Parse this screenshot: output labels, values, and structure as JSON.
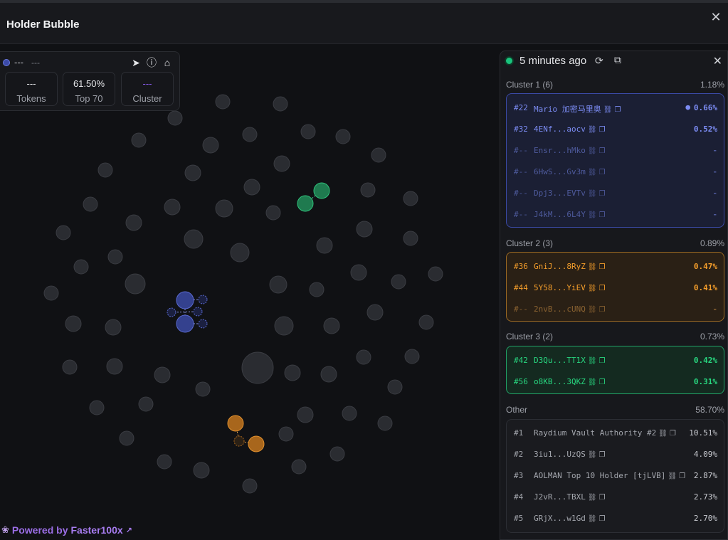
{
  "header": {
    "title": "Holder Bubble",
    "close_icon": "close-icon"
  },
  "token": {
    "name": "---",
    "symbol": "---",
    "stats": [
      {
        "value": "---",
        "label": "Tokens"
      },
      {
        "value": "61.50%",
        "label": "Top 70"
      },
      {
        "value": "---",
        "label": "Cluster"
      }
    ]
  },
  "powered": {
    "prefix": "Powered by",
    "brand": "Faster100x"
  },
  "panel": {
    "updated": "5 minutes ago",
    "clusters": [
      {
        "title": "Cluster 1 (6)",
        "pct": "1.18%",
        "rows": [
          {
            "rank": "#22",
            "addr": "Mario 加密马里奥",
            "val": "0.66%",
            "dim": false,
            "bulb": true
          },
          {
            "rank": "#32",
            "addr": "4ENf...aocv",
            "val": "0.52%",
            "dim": false
          },
          {
            "rank": "#--",
            "addr": "Ensr...hMko",
            "val": "-",
            "dim": true
          },
          {
            "rank": "#--",
            "addr": "6HwS...Gv3m",
            "val": "-",
            "dim": true
          },
          {
            "rank": "#--",
            "addr": "Dpj3...EVTv",
            "val": "-",
            "dim": true
          },
          {
            "rank": "#--",
            "addr": "J4kM...6L4Y",
            "val": "-",
            "dim": true
          }
        ]
      },
      {
        "title": "Cluster 2 (3)",
        "pct": "0.89%",
        "rows": [
          {
            "rank": "#36",
            "addr": "GniJ...8RyZ",
            "val": "0.47%",
            "dim": false
          },
          {
            "rank": "#44",
            "addr": "5Y58...YiEV",
            "val": "0.41%",
            "dim": false
          },
          {
            "rank": "#--",
            "addr": "2nvB...cUNQ",
            "val": "-",
            "dim": true
          }
        ]
      },
      {
        "title": "Cluster 3 (2)",
        "pct": "0.73%",
        "rows": [
          {
            "rank": "#42",
            "addr": "D3Qu...TT1X",
            "val": "0.42%",
            "dim": false
          },
          {
            "rank": "#56",
            "addr": "o8KB...3QKZ",
            "val": "0.31%",
            "dim": false
          }
        ]
      }
    ],
    "other": {
      "title": "Other",
      "pct": "58.70%",
      "rows": [
        {
          "rank": "#1",
          "addr": "Raydium Vault Authority #2",
          "val": "10.51%"
        },
        {
          "rank": "#2",
          "addr": "3iu1...UzQS",
          "val": "4.09%"
        },
        {
          "rank": "#3",
          "addr": "AOLMAN Top 10 Holder [tjLVB]",
          "val": "2.87%"
        },
        {
          "rank": "#4",
          "addr": "J2vR...TBXL",
          "val": "2.73%"
        },
        {
          "rank": "#5",
          "addr": "GRjX...w1Gd",
          "val": "2.70%"
        }
      ]
    }
  },
  "colors": {
    "cluster1": "#3b4aa6",
    "cluster2": "#9c6a23",
    "cluster3": "#21a267",
    "bubble_grey": "#2a2c31",
    "bubble_stroke": "#3a3c42"
  }
}
